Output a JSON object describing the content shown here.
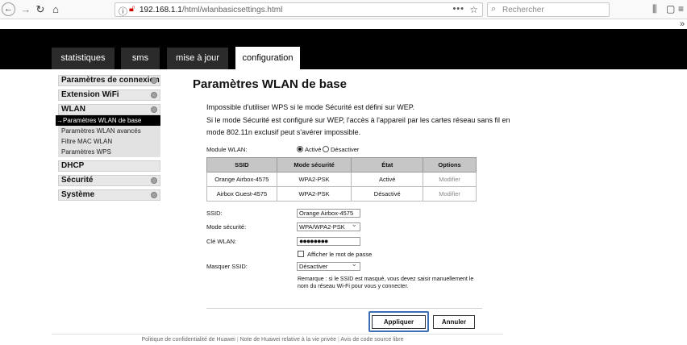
{
  "browser": {
    "url_host": "192.168.1.1",
    "url_path": "/html/wlanbasicsettings.html",
    "more": "•••",
    "search_placeholder": "Rechercher"
  },
  "tabs": [
    {
      "label": "statistiques",
      "active": false
    },
    {
      "label": "sms",
      "active": false
    },
    {
      "label": "mise à jour",
      "active": false
    },
    {
      "label": "configuration",
      "active": true
    }
  ],
  "sidebar": {
    "headers": [
      "Paramètres de connexion",
      "Extension WiFi",
      "WLAN",
      "DHCP",
      "Sécurité",
      "Système"
    ],
    "wlan_items": [
      "Paramètres WLAN de base",
      "Paramètres WLAN avancés",
      "Filtre MAC WLAN",
      "Paramètres WPS"
    ],
    "active_item": "Paramètres WLAN de base"
  },
  "main": {
    "title": "Paramètres WLAN de base",
    "info_lines": [
      "Impossible d'utiliser WPS si le mode Sécurité est défini sur WEP.",
      "Si le mode Sécurité est configuré sur WEP, l'accès à l'appareil par les cartes réseau sans fil en",
      "mode 802.11n exclusif peut s'avérer impossible."
    ],
    "module_label": "Module WLAN:",
    "module_on": "Activé",
    "module_off": "Désactiver",
    "module_state": "on",
    "table": {
      "headers": [
        "SSID",
        "Mode sécurité",
        "État",
        "Options"
      ],
      "rows": [
        [
          "Orange Airbox-4575",
          "WPA2-PSK",
          "Activé",
          "Modifier"
        ],
        [
          "Airbox Guest-4575",
          "WPA2-PSK",
          "Désactivé",
          "Modifier"
        ]
      ]
    },
    "ssid_label": "SSID:",
    "ssid_value": "Orange Airbox-4575",
    "security_label": "Mode sécurité:",
    "security_value": "WPA/WPA2-PSK",
    "key_label": "Clé WLAN:",
    "key_value": "●●●●●●●●",
    "show_password": "Afficher le mot de passe",
    "mask_label": "Masquer SSID:",
    "mask_value": "Désactiver",
    "remark": "Remarque : si le SSID est masqué, vous devez saisir manuellement le nom du réseau Wi-Fi pour vous y connecter.",
    "apply": "Appliquer",
    "cancel": "Annuler"
  },
  "footer": {
    "links": [
      "Politique de confidentialité de Huawei",
      "Note de Huawei relative à la vie privée",
      "Avis de code source libre"
    ],
    "separator": "|"
  }
}
